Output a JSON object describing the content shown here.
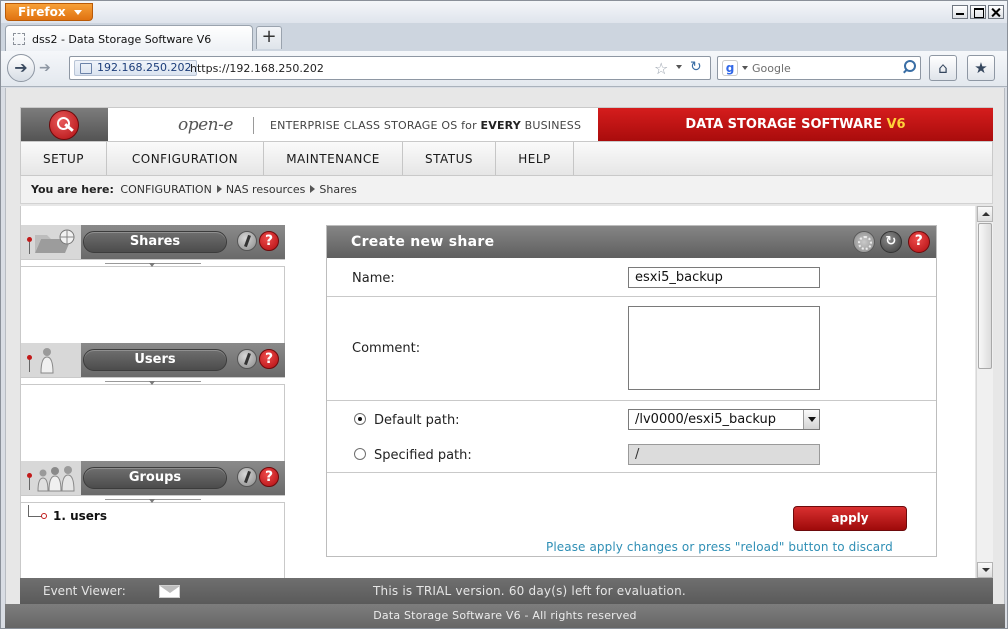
{
  "browser": {
    "app_button": "Firefox",
    "tab_title": "dss2 - Data Storage Software V6",
    "new_tab": "+",
    "site_identity": "192.168.250.202",
    "url": "https://192.168.250.202",
    "search_placeholder": "Google",
    "search_engine_letter": "g"
  },
  "brand": {
    "logo": "open-e",
    "tagline_prefix": "ENTERPRISE CLASS STORAGE OS for ",
    "tagline_emphasis": "EVERY",
    "tagline_suffix": " BUSINESS",
    "product": "DATA STORAGE SOFTWARE ",
    "product_version": "V6"
  },
  "menu": [
    "SETUP",
    "CONFIGURATION",
    "MAINTENANCE",
    "STATUS",
    "HELP"
  ],
  "breadcrumb": {
    "prefix": "You are here:",
    "items": [
      "CONFIGURATION",
      "NAS resources",
      "Shares"
    ]
  },
  "left_panels": {
    "shares": {
      "title": "Shares"
    },
    "users": {
      "title": "Users"
    },
    "groups": {
      "title": "Groups",
      "items": [
        "1. users"
      ]
    }
  },
  "help_glyph": "?",
  "form": {
    "title": "Create new share",
    "name_label": "Name:",
    "name_value": "esxi5_backup",
    "comment_label": "Comment:",
    "comment_value": "",
    "default_path_label": "Default path:",
    "default_path_value": "/lv0000/esxi5_backup",
    "default_path_selected": true,
    "specified_path_label": "Specified path:",
    "specified_path_value": "/",
    "apply_label": "apply",
    "hint": "Please apply changes or press \"reload\" button to discard"
  },
  "status_bar": {
    "event_viewer_label": "Event Viewer:",
    "trial_text": "This is TRIAL version. 60 day(s) left for evaluation."
  },
  "footer": "Data Storage Software V6 - All rights reserved",
  "colors": {
    "brand_red": "#c01515",
    "version_yellow": "#ffd23a",
    "hint_blue": "#2f8fb5",
    "firefox_orange": "#e8821f"
  }
}
